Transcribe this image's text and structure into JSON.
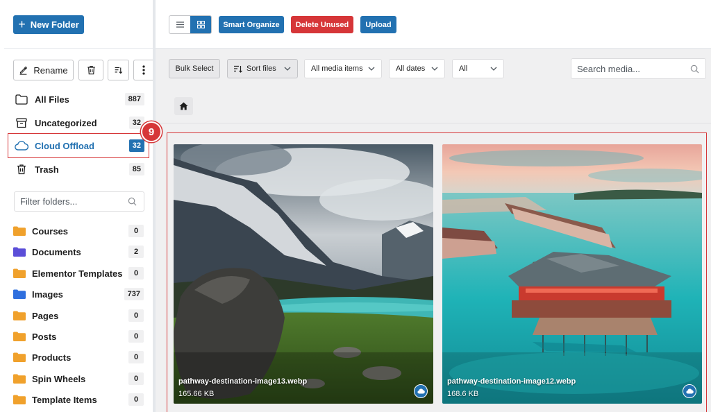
{
  "sidebar": {
    "new_folder_label": "New Folder",
    "rename_label": "Rename",
    "nav": [
      {
        "label": "All Files",
        "count": "887",
        "icon": "folder-icon"
      },
      {
        "label": "Uncategorized",
        "count": "32",
        "icon": "archive-icon"
      },
      {
        "label": "Cloud Offload",
        "count": "32",
        "icon": "cloud-icon"
      },
      {
        "label": "Trash",
        "count": "85",
        "icon": "trash-icon"
      }
    ],
    "filter_placeholder": "Filter folders...",
    "folders": [
      {
        "label": "Courses",
        "count": "0",
        "color": "#f0a12c"
      },
      {
        "label": "Documents",
        "count": "2",
        "color": "#5b4ed8"
      },
      {
        "label": "Elementor Templates",
        "count": "0",
        "color": "#f0a12c"
      },
      {
        "label": "Images",
        "count": "737",
        "color": "#2f6fde"
      },
      {
        "label": "Pages",
        "count": "0",
        "color": "#f0a12c"
      },
      {
        "label": "Posts",
        "count": "0",
        "color": "#f0a12c"
      },
      {
        "label": "Products",
        "count": "0",
        "color": "#f0a12c"
      },
      {
        "label": "Spin Wheels",
        "count": "0",
        "color": "#f0a12c"
      },
      {
        "label": "Template Items",
        "count": "0",
        "color": "#f0a12c"
      }
    ]
  },
  "step_badge": "9",
  "toolbar": {
    "smart_organize": "Smart Organize",
    "delete_unused": "Delete Unused",
    "upload": "Upload"
  },
  "filters": {
    "bulk_select": "Bulk Select",
    "sort_files": "Sort files",
    "media_type": "All media items",
    "dates": "All dates",
    "all": "All",
    "search_placeholder": "Search media..."
  },
  "media": [
    {
      "filename": "pathway-destination-image13.webp",
      "size": "165.66 KB"
    },
    {
      "filename": "pathway-destination-image12.webp",
      "size": "168.6 KB"
    }
  ],
  "colors": {
    "primary": "#2271b1",
    "danger": "#d63638"
  }
}
